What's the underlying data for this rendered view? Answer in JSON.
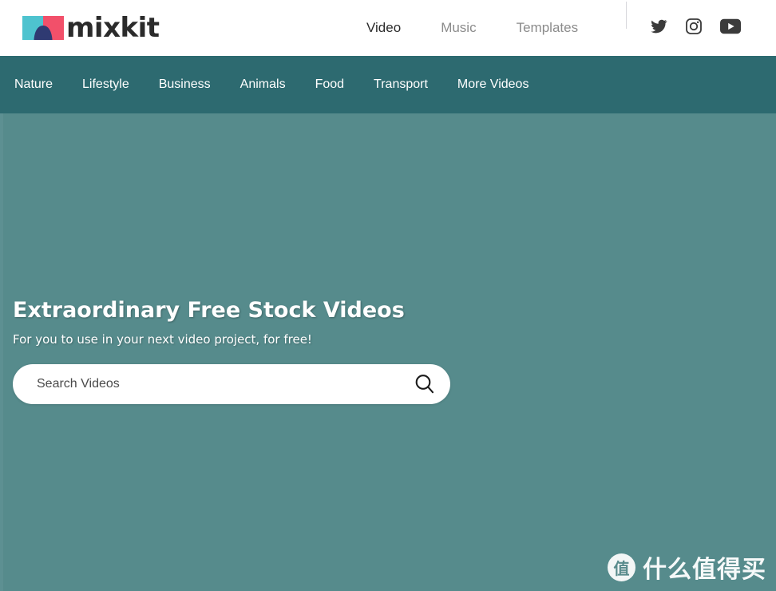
{
  "header": {
    "logo": {
      "wordmark": "mixkit",
      "mark_colors": {
        "left": "#4ec3cf",
        "right": "#f2506a",
        "center": "#2f3a72"
      },
      "icon_name": "mixkit-logo-mark"
    },
    "nav": [
      {
        "label": "Video",
        "active": true
      },
      {
        "label": "Music",
        "active": false
      },
      {
        "label": "Templates",
        "active": false
      }
    ],
    "socials": [
      {
        "name": "twitter-icon",
        "label": "Twitter"
      },
      {
        "name": "instagram-icon",
        "label": "Instagram"
      },
      {
        "name": "youtube-icon",
        "label": "YouTube"
      }
    ]
  },
  "categories": {
    "background": "#2d6a70",
    "items": [
      {
        "label": "Nature"
      },
      {
        "label": "Lifestyle"
      },
      {
        "label": "Business"
      },
      {
        "label": "Animals"
      },
      {
        "label": "Food"
      },
      {
        "label": "Transport"
      },
      {
        "label": "More Videos"
      }
    ]
  },
  "hero": {
    "background": "#568b8c",
    "title": "Extraordinary Free Stock Videos",
    "subtitle": "For you to use in your next video project, for free!",
    "search": {
      "placeholder": "Search Videos",
      "value": "",
      "button_icon": "search-icon"
    }
  },
  "watermark": {
    "badge": "值",
    "text": "什么值得买"
  }
}
